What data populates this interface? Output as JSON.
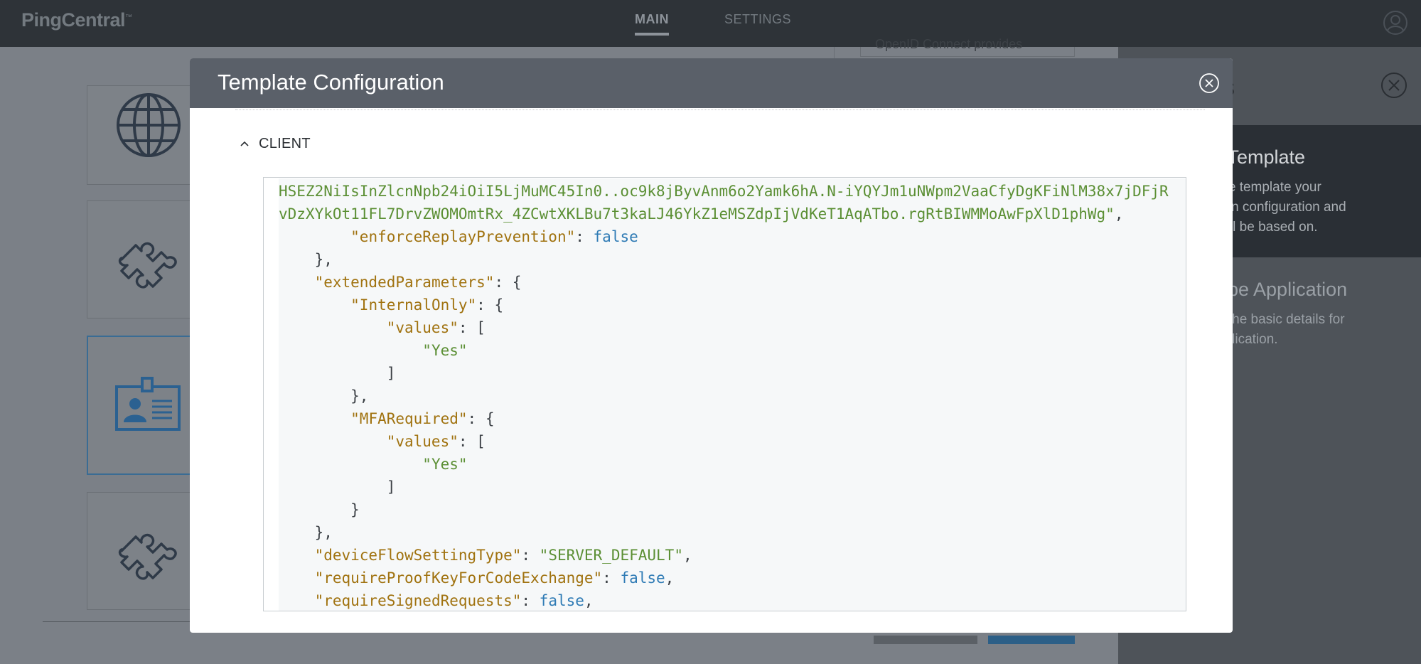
{
  "app": {
    "logo": "PingCentral",
    "logo_tm": "™",
    "nav_tabs": [
      {
        "label": "MAIN",
        "active": true
      },
      {
        "label": "SETTINGS",
        "active": false
      }
    ]
  },
  "background": {
    "card_text": "OpenID Connect provides",
    "side_title_fragment": "s",
    "steps": [
      {
        "title": "t Template",
        "description": "the template your\ntion configuration and\nwill be based on.",
        "active": true
      },
      {
        "title": "ribe Application",
        "description": "e the basic details for\npplication.",
        "active": false
      }
    ]
  },
  "modal": {
    "title": "Template Configuration",
    "section_label": "CLIENT",
    "code_lines": [
      [
        {
          "t": "s",
          "v": "HSEZ2NiIsInZlcnNpb24iOiI5LjMuMC45In0..oc9k8jByvAnm6o2Yamk6hA.N-iYQYJm1uNWpm2VaaCfyDgKFiNlM38x7jDFjR"
        }
      ],
      [
        {
          "t": "s",
          "v": "vDzXYkOt11FL7DrvZWOMOmtRx_4ZCwtXKLBu7t3kaLJ46YkZ1eMSZdpIjVdKeT1AqATbo.rgRtBIWMMoAwFpXlD1phWg\""
        },
        {
          "t": "p",
          "v": ","
        }
      ],
      [
        {
          "t": "p",
          "v": "        "
        },
        {
          "t": "k",
          "v": "\"enforceReplayPrevention\""
        },
        {
          "t": "p",
          "v": ": "
        },
        {
          "t": "b",
          "v": "false"
        }
      ],
      [
        {
          "t": "p",
          "v": "    },"
        }
      ],
      [
        {
          "t": "p",
          "v": "    "
        },
        {
          "t": "k",
          "v": "\"extendedParameters\""
        },
        {
          "t": "p",
          "v": ": {"
        }
      ],
      [
        {
          "t": "p",
          "v": "        "
        },
        {
          "t": "k",
          "v": "\"InternalOnly\""
        },
        {
          "t": "p",
          "v": ": {"
        }
      ],
      [
        {
          "t": "p",
          "v": "            "
        },
        {
          "t": "k",
          "v": "\"values\""
        },
        {
          "t": "p",
          "v": ": ["
        }
      ],
      [
        {
          "t": "p",
          "v": "                "
        },
        {
          "t": "s",
          "v": "\"Yes\""
        }
      ],
      [
        {
          "t": "p",
          "v": "            ]"
        }
      ],
      [
        {
          "t": "p",
          "v": "        },"
        }
      ],
      [
        {
          "t": "p",
          "v": "        "
        },
        {
          "t": "k",
          "v": "\"MFARequired\""
        },
        {
          "t": "p",
          "v": ": {"
        }
      ],
      [
        {
          "t": "p",
          "v": "            "
        },
        {
          "t": "k",
          "v": "\"values\""
        },
        {
          "t": "p",
          "v": ": ["
        }
      ],
      [
        {
          "t": "p",
          "v": "                "
        },
        {
          "t": "s",
          "v": "\"Yes\""
        }
      ],
      [
        {
          "t": "p",
          "v": "            ]"
        }
      ],
      [
        {
          "t": "p",
          "v": "        }"
        }
      ],
      [
        {
          "t": "p",
          "v": "    },"
        }
      ],
      [
        {
          "t": "p",
          "v": "    "
        },
        {
          "t": "k",
          "v": "\"deviceFlowSettingType\""
        },
        {
          "t": "p",
          "v": ": "
        },
        {
          "t": "s",
          "v": "\"SERVER_DEFAULT\""
        },
        {
          "t": "p",
          "v": ","
        }
      ],
      [
        {
          "t": "p",
          "v": "    "
        },
        {
          "t": "k",
          "v": "\"requireProofKeyForCodeExchange\""
        },
        {
          "t": "p",
          "v": ": "
        },
        {
          "t": "b",
          "v": "false"
        },
        {
          "t": "p",
          "v": ","
        }
      ],
      [
        {
          "t": "p",
          "v": "    "
        },
        {
          "t": "k",
          "v": "\"requireSignedRequests\""
        },
        {
          "t": "p",
          "v": ": "
        },
        {
          "t": "b",
          "v": "false"
        },
        {
          "t": "p",
          "v": ","
        }
      ]
    ]
  },
  "colors": {
    "json_key": "#a0720f",
    "json_string": "#5b8f34",
    "json_boolean": "#2f7bb5",
    "modal_header": "#5a6069",
    "topbar": "#2e3338"
  },
  "icons": [
    "globe-icon",
    "puzzle-icon",
    "id-card-icon",
    "user-icon",
    "close-icon",
    "chevron-up-icon"
  ]
}
